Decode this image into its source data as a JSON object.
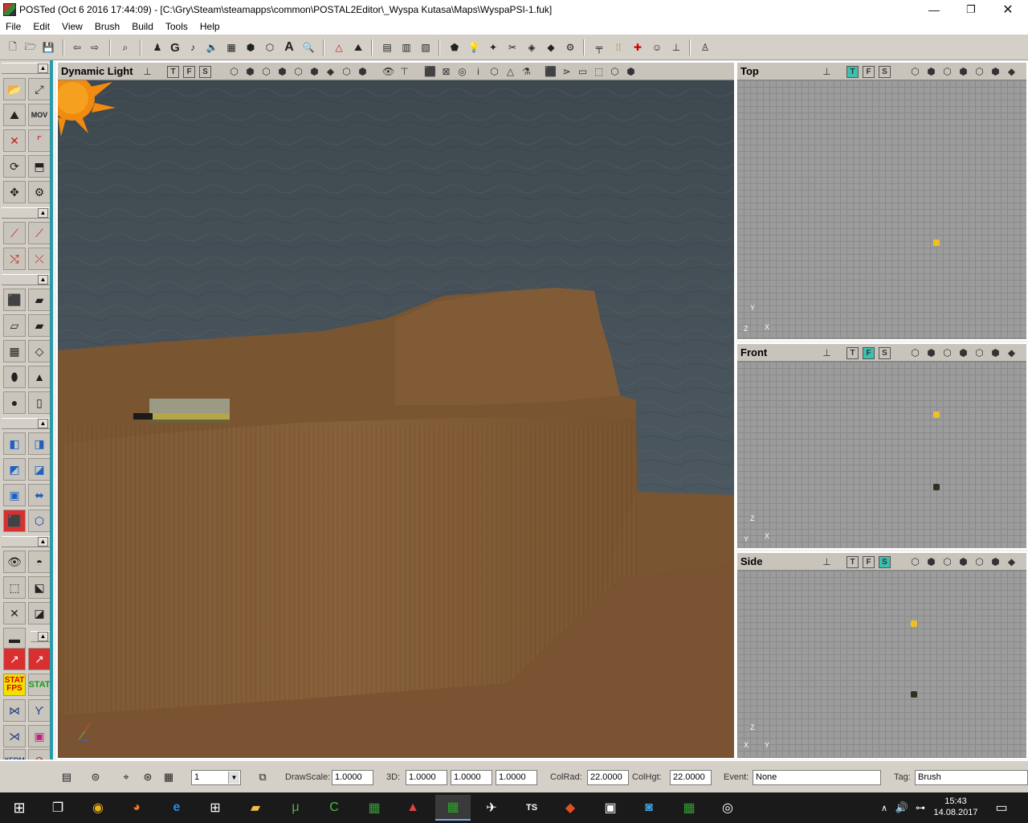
{
  "window": {
    "title": "POSTed (Oct  6 2016 17:44:09) - [C:\\Gry\\Steam\\steamapps\\common\\POSTAL2Editor\\_Wyspa Kutasa\\Maps\\WyspaPSI-1.fuk]",
    "minimize": "—",
    "maximize": "❐",
    "close": "✕"
  },
  "menu": [
    "File",
    "Edit",
    "View",
    "Brush",
    "Build",
    "Tools",
    "Help"
  ],
  "toolbar_icons": [
    "new-file-icon",
    "open-folder-icon",
    "save-icon",
    "undo-icon",
    "redo-icon",
    "search-actors-icon",
    "binoculars-icon",
    "play-map-icon",
    "g-icon",
    "music-icon",
    "sound-icon",
    "texture-icon",
    "mesh-icon",
    "staticmesh-icon",
    "font-icon",
    "zoom-icon",
    "tri-icon",
    "terrain-icon",
    "matinee-icon",
    "script-icon",
    "log-icon",
    "brush-icon",
    "light-icon",
    "bulb-icon",
    "path-icon",
    "cube-icon",
    "settings-icon",
    "gun-icon",
    "ammo-icon",
    "health-icon",
    "face-icon",
    "joystick-icon",
    "pawn-icon"
  ],
  "viewports": {
    "perspective": {
      "title": "Dynamic Light",
      "buttons": [
        "T",
        "F",
        "S"
      ]
    },
    "top": {
      "title": "Top",
      "buttons": [
        "T",
        "F",
        "S"
      ],
      "active": "T",
      "axes": [
        "Y",
        "Z",
        "X"
      ]
    },
    "front": {
      "title": "Front",
      "buttons": [
        "T",
        "F",
        "S"
      ],
      "active": "F",
      "axes": [
        "Z",
        "Y",
        "X"
      ]
    },
    "side": {
      "title": "Side",
      "buttons": [
        "T",
        "F",
        "S"
      ],
      "active": "S",
      "axes": [
        "Z",
        "X",
        "Y"
      ]
    }
  },
  "left_tools": {
    "stat_fps": [
      "STAT",
      "FPS"
    ],
    "stat": "STAT",
    "xfrm": "XFRM"
  },
  "statusbar": {
    "grid_value": "1",
    "drawscale_label": "DrawScale:",
    "drawscale_value": "1.0000",
    "threed_label": "3D:",
    "threed_x": "1.0000",
    "threed_y": "1.0000",
    "threed_z": "1.0000",
    "colrad_label": "ColRad:",
    "colrad_value": "22.0000",
    "colhgt_label": "ColHgt:",
    "colhgt_value": "22.0000",
    "event_label": "Event:",
    "event_value": "None",
    "tag_label": "Tag:",
    "tag_value": "Brush"
  },
  "taskbar": {
    "time": "15:43",
    "date": "14.08.2017"
  },
  "colors": {
    "accent_teal": "#2a9aa8",
    "active_button": "#3ec0b0",
    "sky": "#4a555c",
    "terrain": "#7a5532"
  }
}
